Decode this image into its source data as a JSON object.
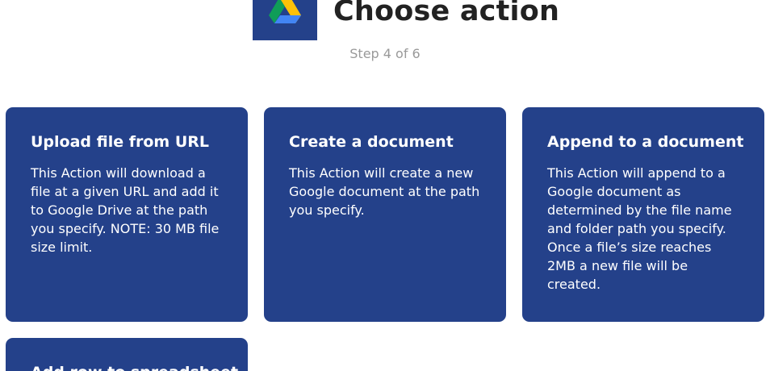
{
  "header": {
    "title": "Choose action",
    "step": "Step 4 of 6",
    "logo_icon": "google-drive-icon",
    "brand_color": "#24418a"
  },
  "actions": [
    {
      "title": "Upload file from URL",
      "description": "This Action will download a file at a given URL and add it to Google Drive at the path you specify. NOTE: 30 MB file size limit."
    },
    {
      "title": "Create a document",
      "description": "This Action will create a new Google document at the path you specify."
    },
    {
      "title": "Append to a document",
      "description": "This Action will append to a Google document as determined by the file name and folder path you specify. Once a file’s size reaches 2MB a new file will be created."
    },
    {
      "title": "Add row to spreadsheet",
      "description": ""
    }
  ]
}
